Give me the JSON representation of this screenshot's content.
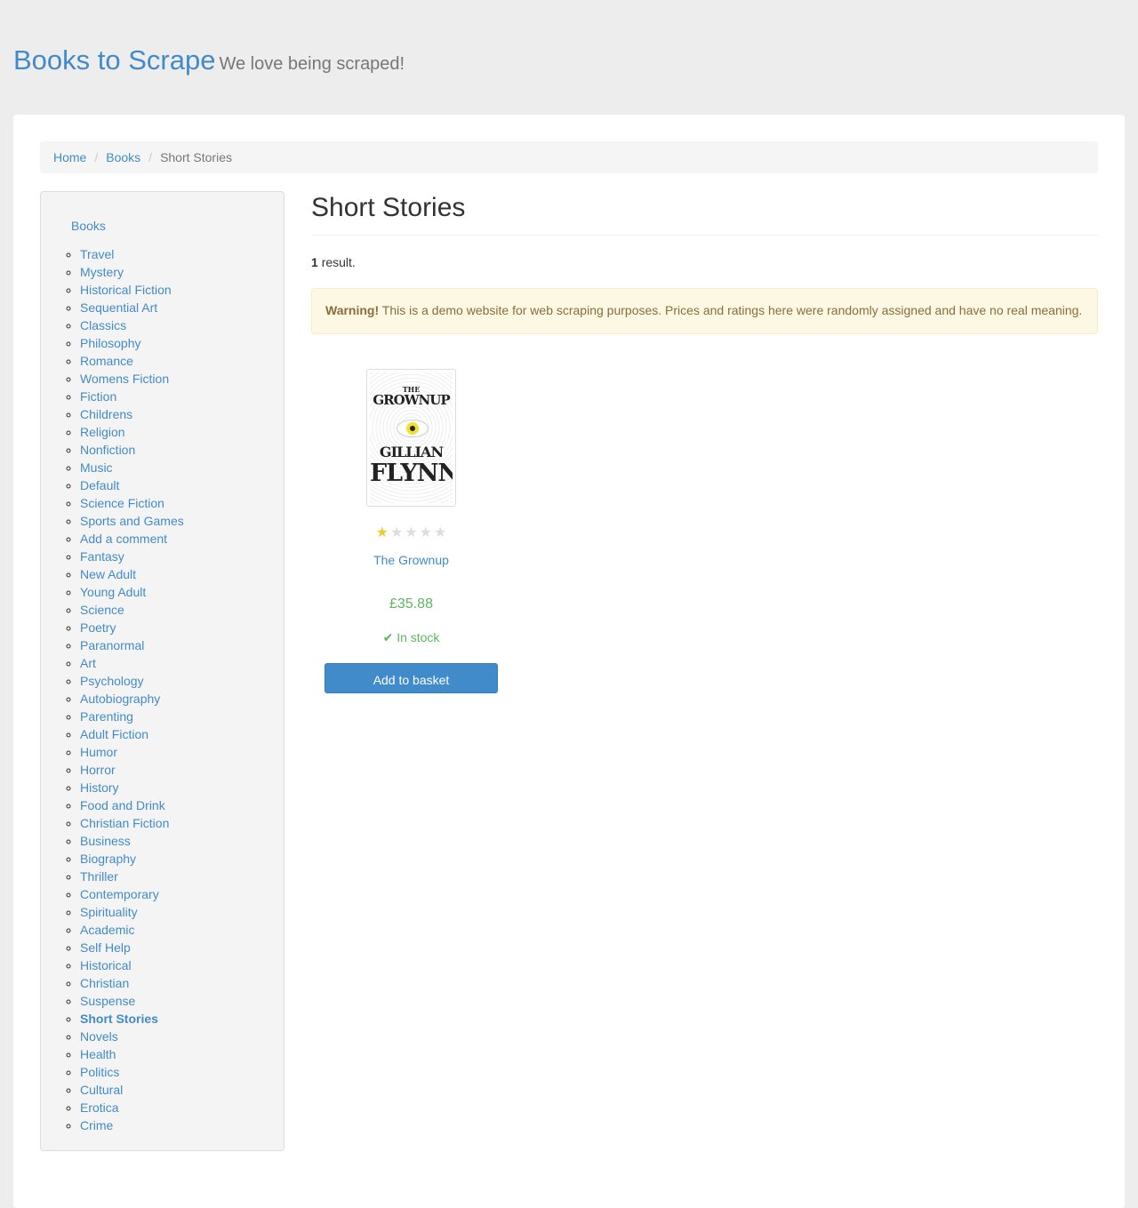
{
  "header": {
    "brand": "Books to Scrape",
    "tagline": "We love being scraped!"
  },
  "breadcrumb": {
    "home": "Home",
    "books": "Books",
    "current": "Short Stories"
  },
  "sidebar": {
    "root_label": "Books",
    "active": "Short Stories",
    "categories": [
      "Travel",
      "Mystery",
      "Historical Fiction",
      "Sequential Art",
      "Classics",
      "Philosophy",
      "Romance",
      "Womens Fiction",
      "Fiction",
      "Childrens",
      "Religion",
      "Nonfiction",
      "Music",
      "Default",
      "Science Fiction",
      "Sports and Games",
      "Add a comment",
      "Fantasy",
      "New Adult",
      "Young Adult",
      "Science",
      "Poetry",
      "Paranormal",
      "Art",
      "Psychology",
      "Autobiography",
      "Parenting",
      "Adult Fiction",
      "Humor",
      "Horror",
      "History",
      "Food and Drink",
      "Christian Fiction",
      "Business",
      "Biography",
      "Thriller",
      "Contemporary",
      "Spirituality",
      "Academic",
      "Self Help",
      "Historical",
      "Christian",
      "Suspense",
      "Short Stories",
      "Novels",
      "Health",
      "Politics",
      "Cultural",
      "Erotica",
      "Crime"
    ]
  },
  "main": {
    "title": "Short Stories",
    "result_count": "1",
    "result_suffix": "result.",
    "warning_label": "Warning!",
    "warning_text": "This is a demo website for web scraping purposes. Prices and ratings here were randomly assigned and have no real meaning."
  },
  "product": {
    "cover_line1": "THE",
    "cover_line2": "GROWNUP",
    "cover_author1": "GILLIAN",
    "cover_author2": "FLYNN",
    "rating": 1,
    "rating_max": 5,
    "title": "The Grownup",
    "price": "£35.88",
    "availability": "In stock",
    "button_label": "Add to basket"
  },
  "colors": {
    "link": "#428bca",
    "success": "#5cb85c",
    "star": "#e6ce31"
  }
}
